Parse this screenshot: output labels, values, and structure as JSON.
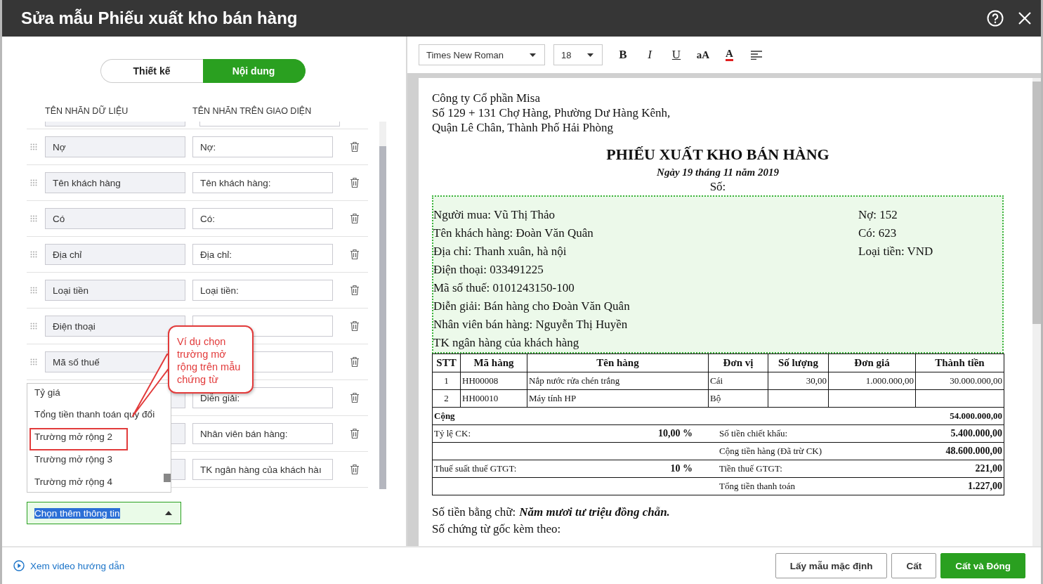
{
  "window": {
    "title": "Sửa mẫu Phiếu xuất kho bán hàng"
  },
  "tabs": [
    {
      "label": "Thiết kế",
      "selected": false
    },
    {
      "label": "Nội dung",
      "selected": true
    }
  ],
  "columns": [
    "TÊN NHÃN DỮ LIỆU",
    "TÊN NHÃN TRÊN GIAO DIỆN"
  ],
  "rows": [
    {
      "data_label": "Nợ",
      "display_label": "Nợ:"
    },
    {
      "data_label": "Tên khách hàng",
      "display_label": "Tên khách hàng:"
    },
    {
      "data_label": "Có",
      "display_label": "Có:"
    },
    {
      "data_label": "Địa chỉ",
      "display_label": "Địa chỉ:"
    },
    {
      "data_label": "Loại tiền",
      "display_label": "Loại tiền:"
    },
    {
      "data_label": "Điện thoại"
    },
    {
      "data_label": "Mã số thuế"
    },
    {
      "display_label": "Diễn giải:"
    },
    {
      "display_label": "Nhân viên bán hàng:"
    },
    {
      "display_label": "TK ngân hàng của khách hàı"
    }
  ],
  "dropdown": {
    "value": "Chọn thêm thông tin",
    "expanded": true,
    "options": [
      {
        "label": "Tỷ giá",
        "highlighted": false
      },
      {
        "label": "Tổng tiền thanh toán quy đổi",
        "highlighted": false
      },
      {
        "label": "Trường mở rộng 2",
        "highlighted": true
      },
      {
        "label": "Trường mở rộng 3",
        "highlighted": false
      },
      {
        "label": "Trường mở rộng 4",
        "highlighted": false
      }
    ]
  },
  "callout": {
    "text": "Ví dụ chọn trường mở rộng trên mẫu chứng từ"
  },
  "toolbar": {
    "font": "Times New Roman",
    "size": "18",
    "buttons": [
      {
        "kind": "bold",
        "label": "B"
      },
      {
        "kind": "italic",
        "label": "I"
      },
      {
        "kind": "underline",
        "label": "U"
      },
      {
        "kind": "case",
        "label": "aA"
      },
      {
        "kind": "color",
        "label": "A",
        "color": "#e02020"
      },
      {
        "kind": "align"
      }
    ]
  },
  "document": {
    "company": [
      "Công ty Cổ phần Misa",
      "Số 129 + 131 Chợ Hàng, Phường Dư Hàng Kênh,",
      "Quận Lê Chân, Thành Phố Hải Phòng"
    ],
    "title": "PHIẾU XUẤT KHO BÁN HÀNG",
    "date": "Ngày 19 tháng 11 năm 2019",
    "number_label": "Số:",
    "info_left": [
      "Người mua: Vũ Thị Thảo",
      "Tên khách hàng: Đoàn Văn Quân",
      "Địa chỉ: Thanh xuân, hà nội",
      "Điện thoại: 033491225",
      "Mã số thuế: 0101243150-100",
      "Diễn giải: Bán hàng cho Đoàn Văn Quân",
      "Nhân viên bán hàng: Nguyễn Thị Huyền",
      "TK ngân hàng của khách hàng"
    ],
    "info_right": [
      "Nợ: 152",
      "Có: 623",
      "Loại tiền: VND"
    ],
    "table": {
      "columns": [
        "STT",
        "Mã hàng",
        "Tên hàng",
        "Đơn vị",
        "Số lượng",
        "Đơn giá",
        "Thành tiền"
      ],
      "rows": [
        [
          "1",
          "HH00008",
          "Nắp nước rửa chén trắng",
          "Cái",
          "30,00",
          "1.000.000,00",
          "30.000.000,00"
        ],
        [
          "2",
          "HH00010",
          "Máy tính HP",
          "Bộ",
          null,
          null,
          null
        ]
      ],
      "total": {
        "label": "Cộng",
        "value": "54.000.000,00"
      },
      "summary": [
        {
          "left_label": "Tỷ lệ CK:",
          "left_value": "10,00 %",
          "right_label": "Số tiền chiết khấu:",
          "right_value": "5.400.000,00"
        },
        {
          "right_label": "Cộng tiền hàng (Đã trừ CK)",
          "right_value": "48.600.000,00"
        },
        {
          "left_label": "Thuế suất thuế GTGT:",
          "left_value": "10 %",
          "right_label": "Tiền thuế GTGT:",
          "right_value": "221,00"
        },
        {
          "right_label": "Tổng tiền thanh toán",
          "right_value": "1.227,00"
        }
      ]
    },
    "amount_in_words": {
      "label": "Số tiền bằng chữ:",
      "value": "Năm mươi tư triệu đồng chẵn."
    },
    "attachments_label": "Số chứng từ gốc kèm theo:"
  },
  "footer": {
    "link": "Xem video hướng dẫn",
    "buttons": [
      {
        "label": "Lấy mẫu mặc định",
        "primary": false
      },
      {
        "label": "Cất",
        "primary": false
      },
      {
        "label": "Cất và Đóng",
        "primary": true
      }
    ]
  }
}
